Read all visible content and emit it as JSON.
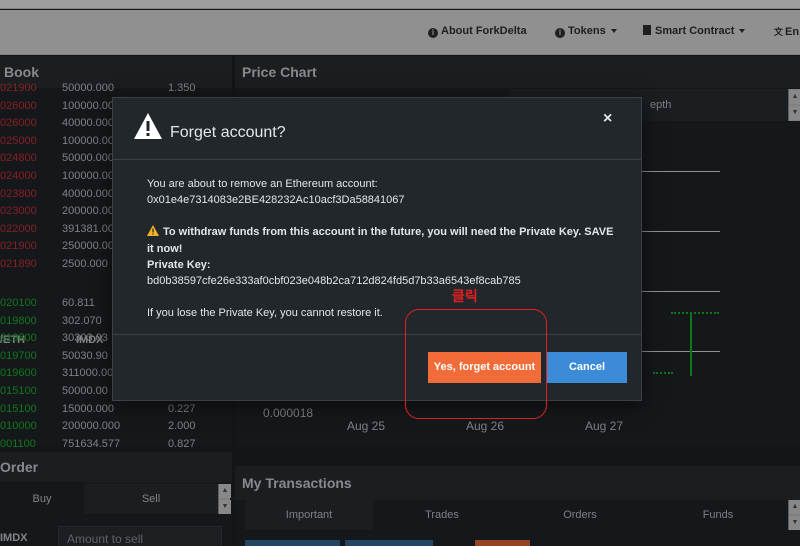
{
  "nav": {
    "about": "About ForkDelta",
    "tokens": "Tokens",
    "smart_contract": "Smart Contract",
    "lang": "En"
  },
  "orderbook": {
    "title": "Book",
    "sells": [
      {
        "price": "021900",
        "amount": "50000.000",
        "total": "1.350"
      },
      {
        "price": "026000",
        "amount": "100000.000",
        "total": ""
      },
      {
        "price": "026000",
        "amount": "40000.000",
        "total": ""
      },
      {
        "price": "025000",
        "amount": "100000.000",
        "total": ""
      },
      {
        "price": "024800",
        "amount": "50000.000",
        "total": ""
      },
      {
        "price": "024000",
        "amount": "100000.000",
        "total": ""
      },
      {
        "price": "023800",
        "amount": "40000.000",
        "total": ""
      },
      {
        "price": "023000",
        "amount": "200000.000",
        "total": ""
      },
      {
        "price": "022000",
        "amount": "391381.000",
        "total": ""
      },
      {
        "price": "021900",
        "amount": "250000.000",
        "total": ""
      },
      {
        "price": "021890",
        "amount": "2500.000",
        "total": ""
      }
    ],
    "col_price": "/ETH",
    "col_amount": "IMDX",
    "buys": [
      {
        "price": "020100",
        "amount": "60.811",
        "total": ""
      },
      {
        "price": "019800",
        "amount": "302.070",
        "total": ""
      },
      {
        "price": "019800",
        "amount": "30303.03",
        "total": ""
      },
      {
        "price": "019700",
        "amount": "50030.90",
        "total": ""
      },
      {
        "price": "019600",
        "amount": "311000.00",
        "total": ""
      },
      {
        "price": "015100",
        "amount": "50000.00",
        "total": ""
      },
      {
        "price": "015100",
        "amount": "15000.000",
        "total": "0.227"
      },
      {
        "price": "010000",
        "amount": "200000.000",
        "total": "2.000"
      },
      {
        "price": "001100",
        "amount": "751634.577",
        "total": "0.827"
      }
    ]
  },
  "order": {
    "title": "Order",
    "tab_buy": "Buy",
    "tab_sell": "Sell",
    "token_label": "IMDX",
    "amount_placeholder": "Amount to sell"
  },
  "price_chart": {
    "title": "Price Chart",
    "depth_label": "epth",
    "y_label": "0.000018",
    "x_labels": [
      "Aug 25",
      "Aug 26",
      "Aug 27"
    ]
  },
  "transactions": {
    "title": "My Transactions",
    "tabs": [
      "Important",
      "Trades",
      "Orders",
      "Funds"
    ]
  },
  "modal": {
    "title": "Forget account?",
    "close": "×",
    "line1": "You are about to remove an Ethereum account:",
    "address": "0x01e4e7314083e2BE428232Ac10acf3Da58841067",
    "warning": "To withdraw funds from this account in the future, you will need the Private Key. SAVE it now!",
    "pk_label": "Private Key:",
    "private_key": "bd0b38597cfe26e333af0cbf023e048b2ca712d824fd5d7b33a6543ef8cab785",
    "restore_note": "If you lose the Private Key, you cannot restore it.",
    "confirm_button": "Yes, forget account",
    "cancel_button": "Cancel"
  },
  "annotation": {
    "text": "클릭",
    "color": "#e02020"
  },
  "colors": {
    "sell": "#d8333a",
    "buy": "#1cbf2c",
    "confirm": "#f26c3a",
    "cancel": "#3b8bd8"
  }
}
